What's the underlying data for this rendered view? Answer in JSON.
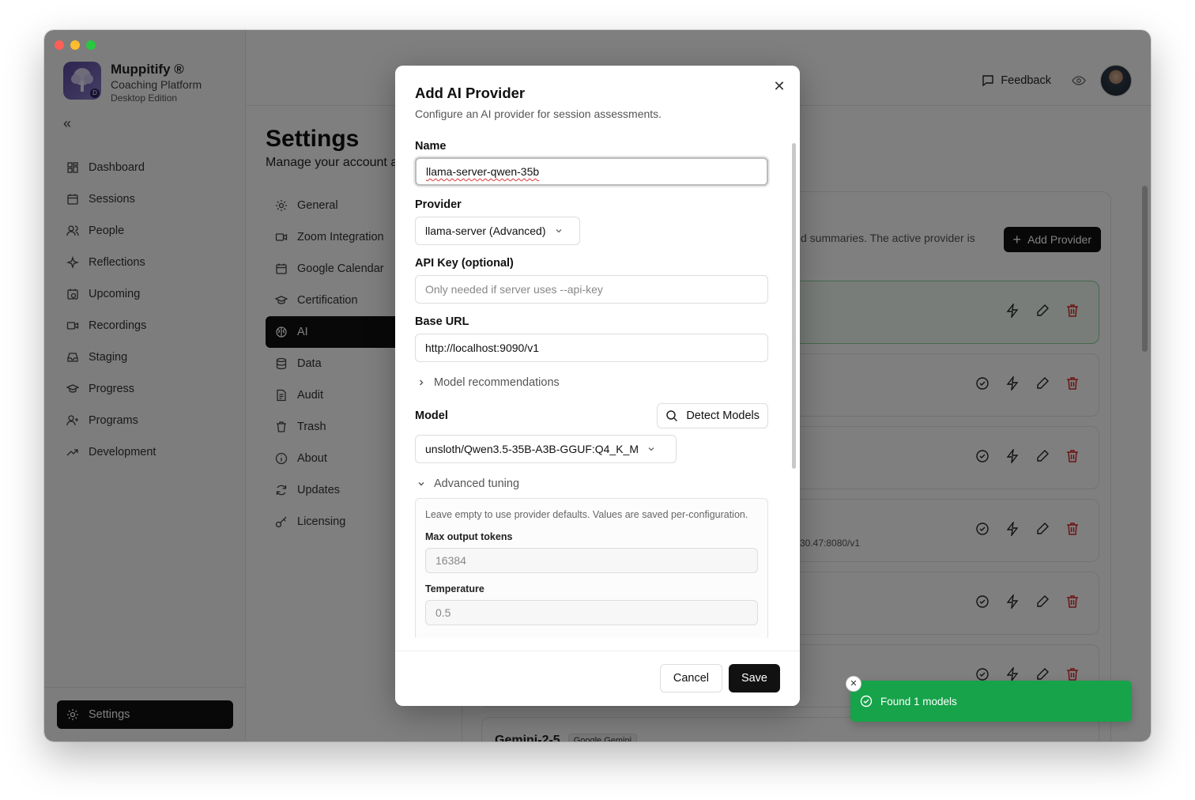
{
  "app": {
    "name": "Muppitify ®",
    "subtitle": "Coaching Platform",
    "edition": "Desktop Edition",
    "logo_badge": "D"
  },
  "sidebar": {
    "collapse_icon": "chevrons-left-icon",
    "items": [
      {
        "label": "Dashboard",
        "icon": "grid-icon"
      },
      {
        "label": "Sessions",
        "icon": "calendar-icon"
      },
      {
        "label": "People",
        "icon": "users-icon"
      },
      {
        "label": "Reflections",
        "icon": "sparkles-icon"
      },
      {
        "label": "Upcoming",
        "icon": "calendar-clock-icon"
      },
      {
        "label": "Recordings",
        "icon": "video-icon"
      },
      {
        "label": "Staging",
        "icon": "inbox-icon"
      },
      {
        "label": "Progress",
        "icon": "graduation-cap-icon"
      },
      {
        "label": "Programs",
        "icon": "user-plus-icon"
      },
      {
        "label": "Development",
        "icon": "trending-up-icon"
      }
    ],
    "settings_label": "Settings"
  },
  "topbar": {
    "feedback_label": "Feedback"
  },
  "settings_page": {
    "title": "Settings",
    "subtitle": "Manage your account a",
    "nav": [
      {
        "label": "General",
        "icon": "gear-icon"
      },
      {
        "label": "Zoom Integration",
        "icon": "video-icon"
      },
      {
        "label": "Google Calendar",
        "icon": "calendar-icon"
      },
      {
        "label": "Certification",
        "icon": "graduation-cap-icon"
      },
      {
        "label": "AI",
        "icon": "brain-icon",
        "active": true
      },
      {
        "label": "Data",
        "icon": "database-icon"
      },
      {
        "label": "Audit",
        "icon": "file-text-icon"
      },
      {
        "label": "Trash",
        "icon": "trash-icon"
      },
      {
        "label": "About",
        "icon": "info-icon"
      },
      {
        "label": "Updates",
        "icon": "refresh-icon"
      },
      {
        "label": "Licensing",
        "icon": "key-icon"
      }
    ],
    "panel_desc": "d summaries. The active provider is",
    "add_provider_label": "Add Provider",
    "card_url_fragment": "30.47:8080/v1",
    "gemini_name": "Gemini-2-5",
    "gemini_tag": "Google Gemini"
  },
  "dialog": {
    "title": "Add AI Provider",
    "subtitle": "Configure an AI provider for session assessments.",
    "name_label": "Name",
    "name_value": "llama-server-qwen-35b",
    "provider_label": "Provider",
    "provider_value": "llama-server (Advanced)",
    "api_key_label": "API Key (optional)",
    "api_key_placeholder": "Only needed if server uses --api-key",
    "base_url_label": "Base URL",
    "base_url_value": "http://localhost:9090/v1",
    "model_recs_label": "Model recommendations",
    "model_label": "Model",
    "detect_label": "Detect Models",
    "model_value": "unsloth/Qwen3.5-35B-A3B-GGUF:Q4_K_M",
    "advanced_label": "Advanced tuning",
    "advanced_note": "Leave empty to use provider defaults. Values are saved per-configuration.",
    "max_tokens_label": "Max output tokens",
    "max_tokens_placeholder": "16384",
    "temperature_label": "Temperature",
    "temperature_placeholder": "0.5",
    "cancel_label": "Cancel",
    "save_label": "Save"
  },
  "toast": {
    "message": "Found 1 models",
    "color": "#16a34a"
  },
  "colors": {
    "accent": "#111111",
    "danger": "#dc2626",
    "success": "#16a34a"
  }
}
